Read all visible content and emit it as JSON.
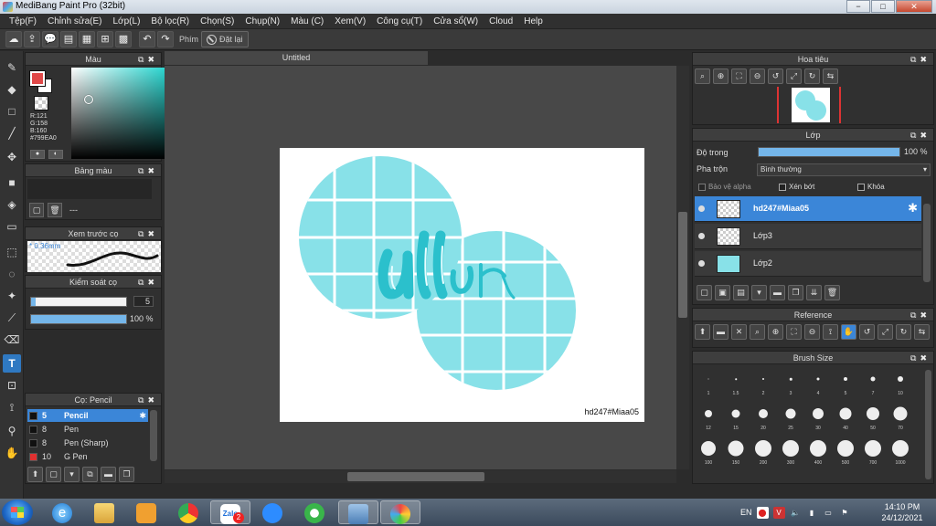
{
  "window": {
    "title": "MediBang Paint Pro (32bit)",
    "min": "−",
    "max": "□",
    "close": "✕"
  },
  "menu": [
    "Tệp(F)",
    "Chỉnh sửa(E)",
    "Lớp(L)",
    "Bộ lọc(R)",
    "Chọn(S)",
    "Chụp(N)",
    "Màu (C)",
    "Xem(V)",
    "Công cụ(T)",
    "Cửa sổ(W)",
    "Cloud",
    "Help"
  ],
  "toolbar": {
    "key_label": "Phím",
    "reset_label": "Đặt lại"
  },
  "color_panel": {
    "title": "Màu",
    "r": "R:121",
    "g": "G:158",
    "b": "B:160",
    "hex": "#799EA0"
  },
  "palette_panel": {
    "title": "Bảng màu",
    "empty": "---"
  },
  "preview_panel": {
    "title": "Xem trước cọ",
    "size": "0.36mm"
  },
  "brush_control": {
    "title": "Kiểm soát cọ",
    "size": "5",
    "opacity": "100 %",
    "size_fraction": 0.05,
    "opacity_fraction": 1.0
  },
  "brush_panel": {
    "title": "Cọ: Pencil",
    "items": [
      {
        "size": "5",
        "name": "Pencil",
        "color": "#111111"
      },
      {
        "size": "8",
        "name": "Pen",
        "color": "#111111"
      },
      {
        "size": "8",
        "name": "Pen (Sharp)",
        "color": "#111111"
      },
      {
        "size": "10",
        "name": "G Pen",
        "color": "#e03030"
      }
    ]
  },
  "canvas": {
    "tab": "Untitled",
    "watermark": "hd247#Miaa05"
  },
  "navigator": {
    "title": "Hoa tiêu"
  },
  "layer_panel": {
    "title": "Lớp",
    "opacity_label": "Độ trong",
    "opacity_value": "100 %",
    "opacity_fraction": 1.0,
    "blend_label": "Pha trộn",
    "blend_value": "Bình thường",
    "protect_alpha": "Bảo vệ alpha",
    "clip": "Xén bớt",
    "lock": "Khóa",
    "layers": [
      {
        "name": "hd247#Miaa05"
      },
      {
        "name": "Lớp3"
      },
      {
        "name": "Lớp2"
      }
    ]
  },
  "reference": {
    "title": "Reference"
  },
  "brush_size": {
    "title": "Brush Size",
    "sizes": [
      "1",
      "1.5",
      "2",
      "3",
      "4",
      "5",
      "7",
      "10",
      "12",
      "15",
      "20",
      "25",
      "30",
      "40",
      "50",
      "70",
      "100",
      "150",
      "200",
      "300",
      "400",
      "500",
      "700",
      "1000"
    ]
  },
  "taskbar": {
    "lang": "EN",
    "time": "14:10 PM",
    "date": "24/12/2021",
    "zalo_badge": "2"
  },
  "colors": {
    "accent": "#3b86d8",
    "paint": "#88e1e8",
    "ink": "#2bc0cc"
  }
}
